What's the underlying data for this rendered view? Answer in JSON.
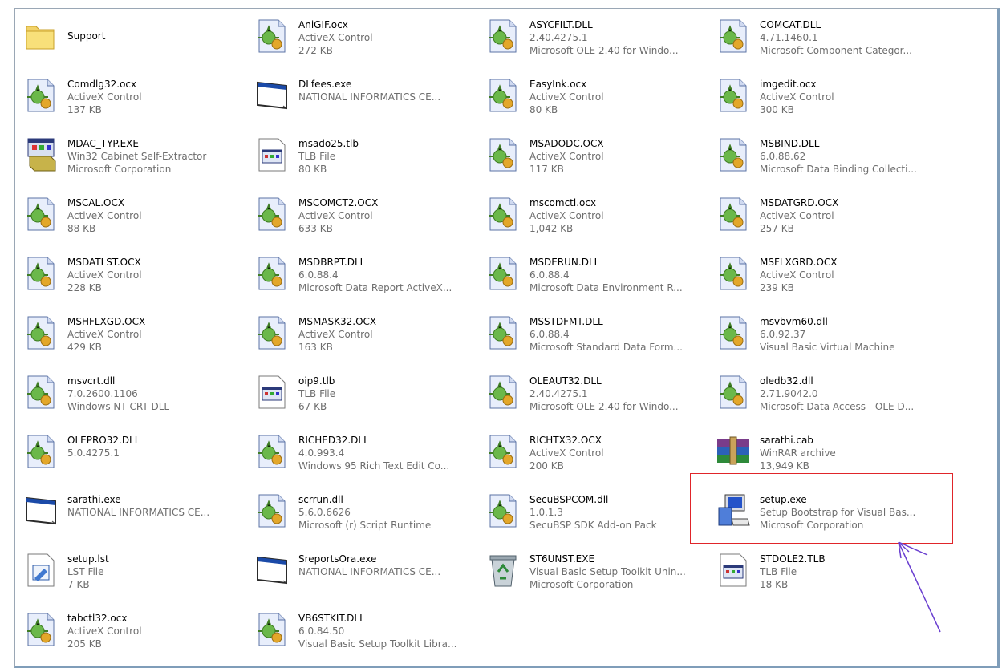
{
  "files": [
    {
      "name": "Support",
      "line2": "",
      "line3": "",
      "icon": "folder-icon"
    },
    {
      "name": "AniGIF.ocx",
      "line2": "ActiveX Control",
      "line3": "272 KB",
      "icon": "activex-control-icon"
    },
    {
      "name": "ASYCFILT.DLL",
      "line2": "2.40.4275.1",
      "line3": "Microsoft OLE 2.40  for Windo...",
      "icon": "activex-control-icon"
    },
    {
      "name": "COMCAT.DLL",
      "line2": "4.71.1460.1",
      "line3": "Microsoft Component Categor...",
      "icon": "activex-control-icon"
    },
    {
      "name": "Comdlg32.ocx",
      "line2": "ActiveX Control",
      "line3": "137 KB",
      "icon": "activex-control-icon"
    },
    {
      "name": "DLfees.exe",
      "line2": "NATIONAL INFORMATICS CE...",
      "line3": "",
      "icon": "application-window-icon"
    },
    {
      "name": "EasyInk.ocx",
      "line2": "ActiveX Control",
      "line3": "80 KB",
      "icon": "activex-control-icon"
    },
    {
      "name": "imgedit.ocx",
      "line2": "ActiveX Control",
      "line3": "300 KB",
      "icon": "activex-control-icon"
    },
    {
      "name": "MDAC_TYP.EXE",
      "line2": "Win32 Cabinet Self-Extractor",
      "line3": "Microsoft Corporation",
      "icon": "installer-box-icon"
    },
    {
      "name": "msado25.tlb",
      "line2": "TLB File",
      "line3": "80 KB",
      "icon": "tlb-file-icon"
    },
    {
      "name": "MSADODC.OCX",
      "line2": "ActiveX Control",
      "line3": "117 KB",
      "icon": "activex-control-icon"
    },
    {
      "name": "MSBIND.DLL",
      "line2": "6.0.88.62",
      "line3": "Microsoft Data Binding Collecti...",
      "icon": "activex-control-icon"
    },
    {
      "name": "MSCAL.OCX",
      "line2": "ActiveX Control",
      "line3": "88 KB",
      "icon": "activex-control-icon"
    },
    {
      "name": "MSCOMCT2.OCX",
      "line2": "ActiveX Control",
      "line3": "633 KB",
      "icon": "activex-control-icon"
    },
    {
      "name": "mscomctl.ocx",
      "line2": "ActiveX Control",
      "line3": "1,042 KB",
      "icon": "activex-control-icon"
    },
    {
      "name": "MSDATGRD.OCX",
      "line2": "ActiveX Control",
      "line3": "257 KB",
      "icon": "activex-control-icon"
    },
    {
      "name": "MSDATLST.OCX",
      "line2": "ActiveX Control",
      "line3": "228 KB",
      "icon": "activex-control-icon"
    },
    {
      "name": "MSDBRPT.DLL",
      "line2": "6.0.88.4",
      "line3": "Microsoft Data Report ActiveX...",
      "icon": "activex-control-icon"
    },
    {
      "name": "MSDERUN.DLL",
      "line2": "6.0.88.4",
      "line3": "Microsoft Data Environment R...",
      "icon": "activex-control-icon"
    },
    {
      "name": "MSFLXGRD.OCX",
      "line2": "ActiveX Control",
      "line3": "239 KB",
      "icon": "activex-control-icon"
    },
    {
      "name": "MSHFLXGD.OCX",
      "line2": "ActiveX Control",
      "line3": "429 KB",
      "icon": "activex-control-icon"
    },
    {
      "name": "MSMASK32.OCX",
      "line2": "ActiveX Control",
      "line3": "163 KB",
      "icon": "activex-control-icon"
    },
    {
      "name": "MSSTDFMT.DLL",
      "line2": "6.0.88.4",
      "line3": "Microsoft Standard Data Form...",
      "icon": "activex-control-icon"
    },
    {
      "name": "msvbvm60.dll",
      "line2": "6.0.92.37",
      "line3": "Visual Basic Virtual Machine",
      "icon": "activex-control-icon"
    },
    {
      "name": "msvcrt.dll",
      "line2": "7.0.2600.1106",
      "line3": "Windows NT CRT DLL",
      "icon": "activex-control-icon"
    },
    {
      "name": "oip9.tlb",
      "line2": "TLB File",
      "line3": "67 KB",
      "icon": "tlb-file-icon"
    },
    {
      "name": "OLEAUT32.DLL",
      "line2": "2.40.4275.1",
      "line3": "Microsoft OLE 2.40  for Windo...",
      "icon": "activex-control-icon"
    },
    {
      "name": "oledb32.dll",
      "line2": "2.71.9042.0",
      "line3": "Microsoft Data Access - OLE D...",
      "icon": "activex-control-icon"
    },
    {
      "name": "OLEPRO32.DLL",
      "line2": "5.0.4275.1",
      "line3": "",
      "icon": "activex-control-icon"
    },
    {
      "name": "RICHED32.DLL",
      "line2": "4.0.993.4",
      "line3": "Windows 95 Rich Text Edit Co...",
      "icon": "activex-control-icon"
    },
    {
      "name": "RICHTX32.OCX",
      "line2": "ActiveX Control",
      "line3": "200 KB",
      "icon": "activex-control-icon"
    },
    {
      "name": "sarathi.cab",
      "line2": "WinRAR archive",
      "line3": "13,949 KB",
      "icon": "winrar-archive-icon"
    },
    {
      "name": "sarathi.exe",
      "line2": "NATIONAL INFORMATICS CE...",
      "line3": "",
      "icon": "application-window-icon"
    },
    {
      "name": "scrrun.dll",
      "line2": "5.6.0.6626",
      "line3": "Microsoft (r) Script Runtime",
      "icon": "activex-control-icon"
    },
    {
      "name": "SecuBSPCOM.dll",
      "line2": "1.0.1.3",
      "line3": "SecuBSP SDK Add-on Pack",
      "icon": "activex-control-icon"
    },
    {
      "name": "setup.exe",
      "line2": "Setup Bootstrap for Visual Bas...",
      "line3": "Microsoft Corporation",
      "icon": "setup-computer-icon"
    },
    {
      "name": "setup.lst",
      "line2": "LST File",
      "line3": "7 KB",
      "icon": "lst-file-icon"
    },
    {
      "name": "SreportsOra.exe",
      "line2": "NATIONAL INFORMATICS CE...",
      "line3": "",
      "icon": "application-window-icon"
    },
    {
      "name": "ST6UNST.EXE",
      "line2": "Visual Basic Setup Toolkit Unin...",
      "line3": "Microsoft Corporation",
      "icon": "recycle-bin-icon"
    },
    {
      "name": "STDOLE2.TLB",
      "line2": "TLB File",
      "line3": "18 KB",
      "icon": "tlb-file-icon"
    },
    {
      "name": "tabctl32.ocx",
      "line2": "ActiveX Control",
      "line3": "205 KB",
      "icon": "activex-control-icon"
    },
    {
      "name": "VB6STKIT.DLL",
      "line2": "6.0.84.50",
      "line3": "Visual Basic Setup Toolkit Libra...",
      "icon": "activex-control-icon"
    }
  ],
  "annotation": {
    "highlight_color": "#e0252a",
    "arrow_color": "#6a3fd0"
  }
}
